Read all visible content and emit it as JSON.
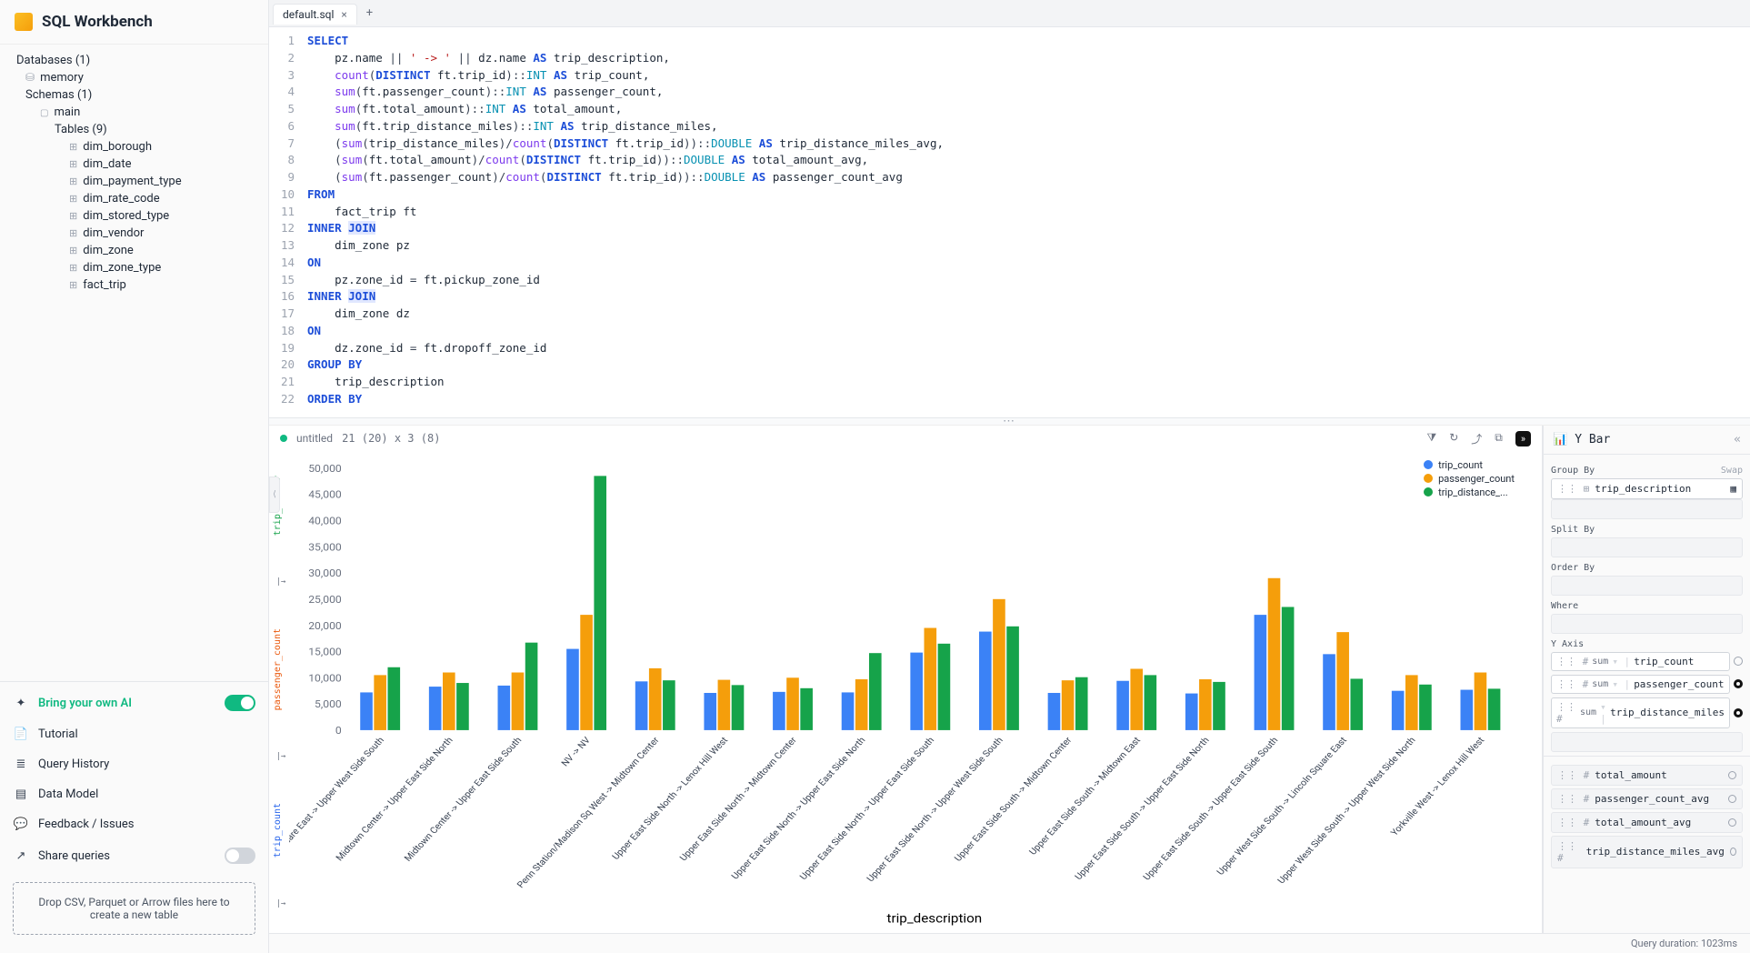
{
  "app": {
    "title": "SQL Workbench"
  },
  "tree": {
    "databases_label": "Databases (1)",
    "db_name": "memory",
    "schemas_label": "Schemas (1)",
    "schema_name": "main",
    "tables_label": "Tables (9)",
    "tables": [
      "dim_borough",
      "dim_date",
      "dim_payment_type",
      "dim_rate_code",
      "dim_stored_type",
      "dim_vendor",
      "dim_zone",
      "dim_zone_type",
      "fact_trip"
    ]
  },
  "footer": {
    "byoai": "Bring your own AI",
    "tutorial": "Tutorial",
    "history": "Query History",
    "datamodel": "Data Model",
    "feedback": "Feedback / Issues",
    "share": "Share queries",
    "dropzone": "Drop CSV, Parquet or Arrow files here to create a new table"
  },
  "tabs": {
    "active": "default.sql"
  },
  "editor": {
    "lines": [
      [
        [
          "kw",
          "SELECT"
        ]
      ],
      [
        [
          "",
          "    pz.name "
        ],
        [
          "op",
          "||"
        ],
        [
          "str",
          " ' -> ' "
        ],
        [
          "op",
          "||"
        ],
        [
          "",
          " dz.name "
        ],
        [
          "kw",
          "AS"
        ],
        [
          "",
          " trip_description,"
        ]
      ],
      [
        [
          "",
          "    "
        ],
        [
          "fn",
          "count"
        ],
        [
          "op",
          "("
        ],
        [
          "kw",
          "DISTINCT"
        ],
        [
          "",
          " ft.trip_id"
        ],
        [
          "op",
          ")::"
        ],
        [
          "ty",
          "INT"
        ],
        [
          "",
          " "
        ],
        [
          "kw",
          "AS"
        ],
        [
          "",
          " trip_count,"
        ]
      ],
      [
        [
          "",
          "    "
        ],
        [
          "fn",
          "sum"
        ],
        [
          "op",
          "("
        ],
        [
          "",
          "ft.passenger_count"
        ],
        [
          "op",
          ")::"
        ],
        [
          "ty",
          "INT"
        ],
        [
          "",
          " "
        ],
        [
          "kw",
          "AS"
        ],
        [
          "",
          " passenger_count,"
        ]
      ],
      [
        [
          "",
          "    "
        ],
        [
          "fn",
          "sum"
        ],
        [
          "op",
          "("
        ],
        [
          "",
          "ft.total_amount"
        ],
        [
          "op",
          ")::"
        ],
        [
          "ty",
          "INT"
        ],
        [
          "",
          " "
        ],
        [
          "kw",
          "AS"
        ],
        [
          "",
          " total_amount,"
        ]
      ],
      [
        [
          "",
          "    "
        ],
        [
          "fn",
          "sum"
        ],
        [
          "op",
          "("
        ],
        [
          "",
          "ft.trip_distance_miles"
        ],
        [
          "op",
          ")::"
        ],
        [
          "ty",
          "INT"
        ],
        [
          "",
          " "
        ],
        [
          "kw",
          "AS"
        ],
        [
          "",
          " trip_distance_miles,"
        ]
      ],
      [
        [
          "",
          "    "
        ],
        [
          "op",
          "("
        ],
        [
          "fn",
          "sum"
        ],
        [
          "op",
          "("
        ],
        [
          "",
          "trip_distance_miles"
        ],
        [
          "op",
          ")/"
        ],
        [
          "fn",
          "count"
        ],
        [
          "op",
          "("
        ],
        [
          "kw",
          "DISTINCT"
        ],
        [
          "",
          " ft.trip_id"
        ],
        [
          "op",
          "))::"
        ],
        [
          "ty",
          "DOUBLE"
        ],
        [
          "",
          " "
        ],
        [
          "kw",
          "AS"
        ],
        [
          "",
          " trip_distance_miles_avg,"
        ]
      ],
      [
        [
          "",
          "    "
        ],
        [
          "op",
          "("
        ],
        [
          "fn",
          "sum"
        ],
        [
          "op",
          "("
        ],
        [
          "",
          "ft.total_amount"
        ],
        [
          "op",
          ")/"
        ],
        [
          "fn",
          "count"
        ],
        [
          "op",
          "("
        ],
        [
          "kw",
          "DISTINCT"
        ],
        [
          "",
          " ft.trip_id"
        ],
        [
          "op",
          "))::"
        ],
        [
          "ty",
          "DOUBLE"
        ],
        [
          "",
          " "
        ],
        [
          "kw",
          "AS"
        ],
        [
          "",
          " total_amount_avg,"
        ]
      ],
      [
        [
          "",
          "    "
        ],
        [
          "op",
          "("
        ],
        [
          "fn",
          "sum"
        ],
        [
          "op",
          "("
        ],
        [
          "",
          "ft.passenger_count"
        ],
        [
          "op",
          ")/"
        ],
        [
          "fn",
          "count"
        ],
        [
          "op",
          "("
        ],
        [
          "kw",
          "DISTINCT"
        ],
        [
          "",
          " ft.trip_id"
        ],
        [
          "op",
          "))::"
        ],
        [
          "ty",
          "DOUBLE"
        ],
        [
          "",
          " "
        ],
        [
          "kw",
          "AS"
        ],
        [
          "",
          " passenger_count_avg"
        ]
      ],
      [
        [
          "kw",
          "FROM"
        ]
      ],
      [
        [
          "",
          "    fact_trip ft"
        ]
      ],
      [
        [
          "kw",
          "INNER "
        ],
        [
          "kwhl",
          "JOIN"
        ]
      ],
      [
        [
          "",
          "    dim_zone pz"
        ]
      ],
      [
        [
          "kw",
          "ON"
        ]
      ],
      [
        [
          "",
          "    pz.zone_id "
        ],
        [
          "op",
          "="
        ],
        [
          "",
          " ft.pickup_zone_id"
        ]
      ],
      [
        [
          "kw",
          "INNER "
        ],
        [
          "kwhl",
          "JOIN"
        ]
      ],
      [
        [
          "",
          "    dim_zone dz"
        ]
      ],
      [
        [
          "kw",
          "ON"
        ]
      ],
      [
        [
          "",
          "    dz.zone_id "
        ],
        [
          "op",
          "="
        ],
        [
          "",
          " ft.dropoff_zone_id"
        ]
      ],
      [
        [
          "kw",
          "GROUP BY"
        ]
      ],
      [
        [
          "",
          "    trip_description"
        ]
      ],
      [
        [
          "kw",
          "ORDER BY"
        ]
      ]
    ]
  },
  "result_meta": {
    "name": "untitled",
    "shape": "21 (20) x 3 (8)"
  },
  "chart_data": {
    "type": "bar",
    "title": "",
    "xlabel": "trip_description",
    "yticks": [
      0,
      5000,
      10000,
      15000,
      20000,
      25000,
      30000,
      35000,
      40000,
      45000,
      50000
    ],
    "ylim": [
      0,
      50000
    ],
    "categories": [
      "Lincoln Square East -> Upper West Side South",
      "Midtown Center -> Upper East Side North",
      "Midtown Center -> Upper East Side South",
      "NV -> NV",
      "Penn Station/Madison Sq West -> Midtown Center",
      "Upper East Side North -> Lenox Hill West",
      "Upper East Side North -> Midtown Center",
      "Upper East Side North -> Upper East Side North",
      "Upper East Side North -> Upper East Side South",
      "Upper East Side North -> Upper West Side South",
      "Upper East Side South -> Midtown Center",
      "Upper East Side South -> Midtown East",
      "Upper East Side South -> Upper East Side North",
      "Upper East Side South -> Upper East Side South",
      "Upper West Side South -> Lincoln Square East",
      "Upper West Side South -> Upper West Side North",
      "Yorkville West -> Lenox Hill West"
    ],
    "series": [
      {
        "name": "trip_count",
        "color": "#3b82f6",
        "values": [
          7200,
          8300,
          8500,
          15500,
          9300,
          7100,
          7300,
          7200,
          14800,
          18800,
          7100,
          9400,
          7000,
          22000,
          14500,
          7500,
          7700
        ]
      },
      {
        "name": "passenger_count",
        "color": "#f59e0b",
        "values": [
          10500,
          11000,
          11000,
          22000,
          11800,
          9600,
          10000,
          9700,
          19500,
          25000,
          9500,
          11700,
          9700,
          29000,
          18700,
          10500,
          11000
        ]
      },
      {
        "name": "trip_distance_...",
        "color": "#16a34a",
        "values": [
          12000,
          9000,
          16700,
          48500,
          9500,
          8600,
          8000,
          14700,
          16500,
          19800,
          10100,
          10500,
          9200,
          23500,
          9800,
          8700,
          7900
        ]
      }
    ]
  },
  "config": {
    "chart_type": "Y Bar",
    "groupby_label": "Group By",
    "swap": "Swap",
    "groupby_value": "trip_description",
    "splitby_label": "Split By",
    "orderby_label": "Order By",
    "where_label": "Where",
    "yaxis_label": "Y Axis",
    "yaxis": [
      {
        "agg": "sum",
        "field": "trip_count",
        "on": false
      },
      {
        "agg": "sum",
        "field": "passenger_count",
        "on": true
      },
      {
        "agg": "sum",
        "field": "trip_distance_miles",
        "on": true
      }
    ],
    "unused": [
      "total_amount",
      "passenger_count_avg",
      "total_amount_avg",
      "trip_distance_miles_avg"
    ]
  },
  "status": {
    "duration": "Query duration: 1023ms"
  },
  "yaxis_strip": {
    "a": "trip_distar",
    "b": "passenger_count",
    "c": "trip_count"
  }
}
